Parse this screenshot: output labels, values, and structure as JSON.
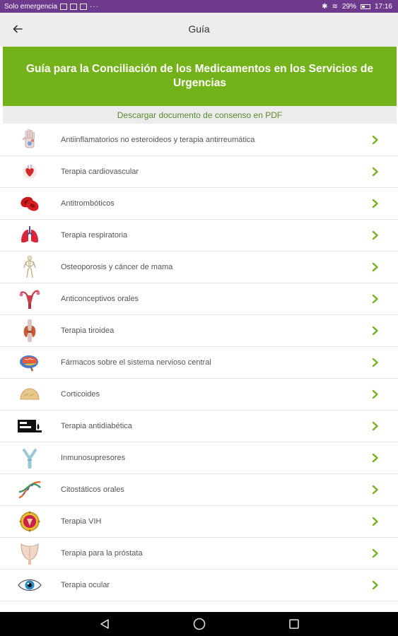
{
  "status_bar": {
    "carrier": "Solo emergencia",
    "battery": "29%",
    "time": "17:16"
  },
  "app_bar": {
    "title": "Guía",
    "back_icon": "arrow-left-icon"
  },
  "banner": {
    "title": "Guía para la Conciliación de los Medicamentos en los Servicios de Urgencias",
    "color": "#74b21b"
  },
  "download_link": "Descargar documento de consenso en PDF",
  "accent_color": "#74b21b",
  "items": [
    {
      "label": "Antiinflamatorios no esteroideos y terapia antirreumática",
      "icon": "hand-icon"
    },
    {
      "label": "Terapia cardiovascular",
      "icon": "heart-icon"
    },
    {
      "label": "Antitrombóticos",
      "icon": "blood-cells-icon"
    },
    {
      "label": "Terapia respiratoria",
      "icon": "lungs-icon"
    },
    {
      "label": "Osteoporosis y cáncer de mama",
      "icon": "skeleton-icon"
    },
    {
      "label": "Anticonceptivos orales",
      "icon": "uterus-icon"
    },
    {
      "label": "Terapia tiroidea",
      "icon": "thyroid-icon"
    },
    {
      "label": "Fármacos sobre el sistema nervioso central",
      "icon": "brain-icon"
    },
    {
      "label": "Corticoides",
      "icon": "adrenal-gland-icon"
    },
    {
      "label": "Terapia antidiabética",
      "icon": "glucose-meter-icon"
    },
    {
      "label": "Inmunosupresores",
      "icon": "antibody-icon"
    },
    {
      "label": "Citostáticos orales",
      "icon": "dna-icon"
    },
    {
      "label": "Terapia VIH",
      "icon": "virus-icon"
    },
    {
      "label": "Terapia para la próstata",
      "icon": "prostate-icon"
    },
    {
      "label": "Terapia ocular",
      "icon": "eye-icon"
    }
  ],
  "nav_bar": [
    "back-triangle-icon",
    "home-circle-icon",
    "recents-square-icon"
  ]
}
